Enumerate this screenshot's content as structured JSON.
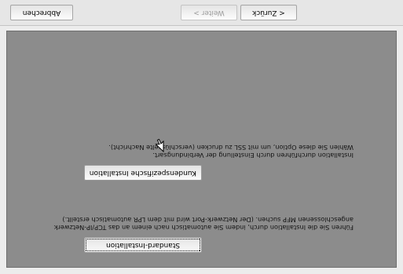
{
  "options": [
    {
      "label": "Standard-Installation",
      "description": [
        "Führen Sie die Installation durch, indem Sie automatisch nach einem an das TCP/IP-Netzwerk",
        "angeschlossenen MFP suchen. (Der Netzwerk-Port wird mit dem LPR automatisch erstellt.)"
      ]
    },
    {
      "label": "Kundenspezifische Installation",
      "description": [
        "Installation durchführen durch Einstellung der Verbindungsart.",
        "Wählen Sie diese Option, um mit SSL zu drucken (verschlüsselte Nachricht)."
      ]
    }
  ],
  "nav": {
    "back": "< Zurück",
    "next": "Weiter >",
    "cancel": "Abbrechen"
  },
  "icons": [
    "mouse-pointer-icon"
  ]
}
